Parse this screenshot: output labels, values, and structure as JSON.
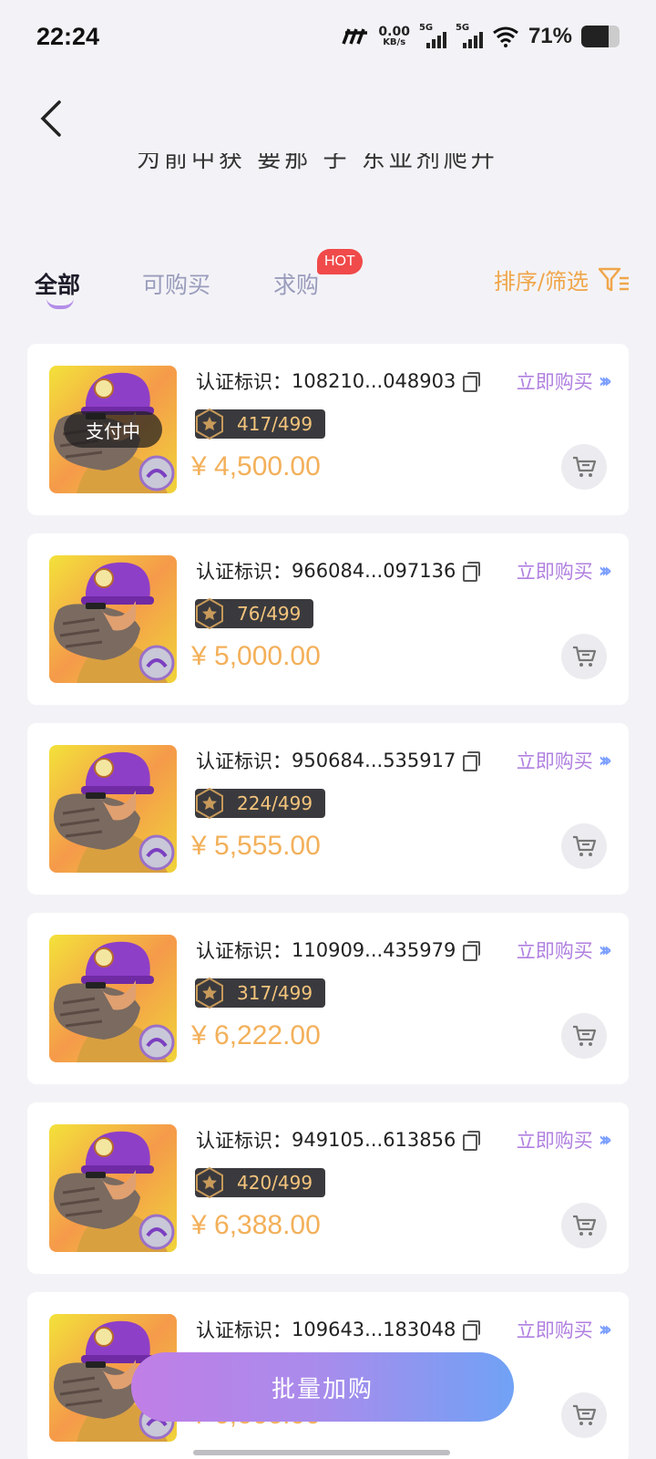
{
  "status_bar": {
    "time": "22:24",
    "net_speed_value": "0.00",
    "net_speed_unit": "KB/s",
    "sim1_label": "5G",
    "sim2_label": "5G",
    "battery_percent": "71%",
    "battery_level": 0.71
  },
  "header": {
    "partial_heading": "为前中获 要那 子 东亚剂爬升",
    "back_icon": "chevron-left-icon"
  },
  "tabs": [
    {
      "label": "全部",
      "active": true
    },
    {
      "label": "可购买",
      "active": false
    },
    {
      "label": "求购",
      "active": false
    }
  ],
  "hot_badge": "HOT",
  "sort_filter": {
    "label": "排序/筛选",
    "icon": "filter-icon"
  },
  "items": [
    {
      "cert_label": "认证标识：",
      "cert_id": "108210...048903",
      "buy_label": "立即购买",
      "serial": "417/499",
      "price": "¥ 4,500.00",
      "status": "支付中"
    },
    {
      "cert_label": "认证标识：",
      "cert_id": "966084...097136",
      "buy_label": "立即购买",
      "serial": "76/499",
      "price": "¥ 5,000.00",
      "status": ""
    },
    {
      "cert_label": "认证标识：",
      "cert_id": "950684...535917",
      "buy_label": "立即购买",
      "serial": "224/499",
      "price": "¥ 5,555.00",
      "status": ""
    },
    {
      "cert_label": "认证标识：",
      "cert_id": "110909...435979",
      "buy_label": "立即购买",
      "serial": "317/499",
      "price": "¥ 6,222.00",
      "status": ""
    },
    {
      "cert_label": "认证标识：",
      "cert_id": "949105...613856",
      "buy_label": "立即购买",
      "serial": "420/499",
      "price": "¥ 6,388.00",
      "status": ""
    },
    {
      "cert_label": "认证标识：",
      "cert_id": "109643...183048",
      "buy_label": "立即购买",
      "serial": "",
      "price": "¥ 6,666.00",
      "status": ""
    }
  ],
  "batch_button": "批量加购",
  "colors": {
    "accent_orange": "#f3b05a",
    "buy_purple": "#b080e0",
    "tab_inactive": "#9a9cbc",
    "hot_red": "#f04a4a",
    "gradient_start": "#c07ee6",
    "gradient_end": "#70a2f5"
  }
}
